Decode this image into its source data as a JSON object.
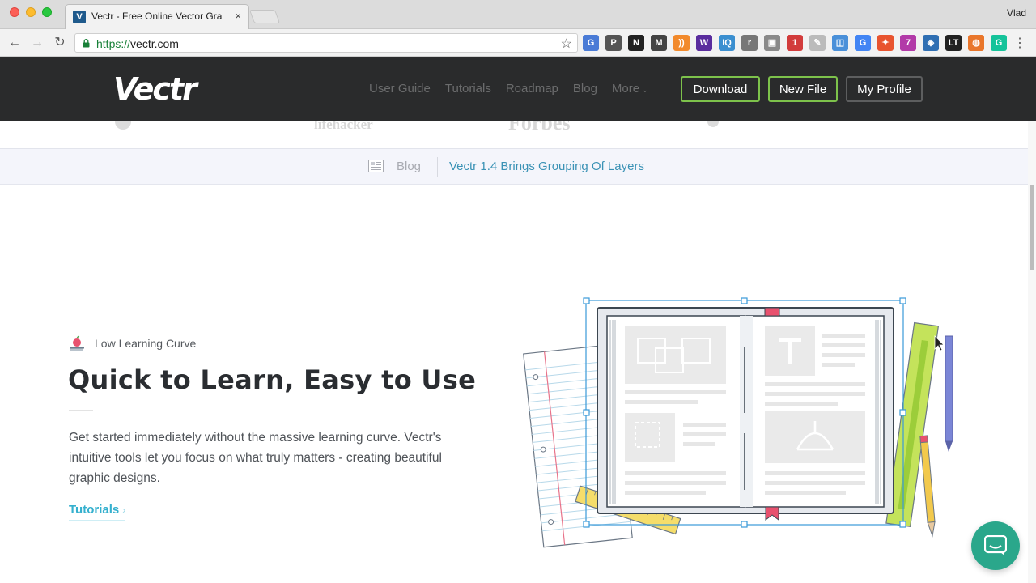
{
  "browser": {
    "tab_title": "Vectr - Free Online Vector Gra",
    "tab_favicon": "V",
    "tab_close": "×",
    "user": "Vlad",
    "url_scheme": "https://",
    "url_host": "vectr.com",
    "back_icon": "←",
    "forward_icon": "→",
    "reload_icon": "↻",
    "star_icon": "☆",
    "menu_icon": "⋮",
    "extensions": [
      {
        "label": "G",
        "color": "#4a7bd6"
      },
      {
        "label": "P",
        "color": "#555555"
      },
      {
        "label": "N",
        "color": "#222222"
      },
      {
        "label": "M",
        "color": "#444444"
      },
      {
        "label": "))",
        "color": "#f28a2c"
      },
      {
        "label": "W",
        "color": "#5a2d9e"
      },
      {
        "label": "IQ",
        "color": "#3b8fd0"
      },
      {
        "label": "r",
        "color": "#777777"
      },
      {
        "label": "▣",
        "color": "#8a8a8a"
      },
      {
        "label": "1",
        "color": "#d23c3c"
      },
      {
        "label": "✎",
        "color": "#bbbbbb"
      },
      {
        "label": "◫",
        "color": "#4a90d9"
      },
      {
        "label": "G",
        "color": "#4285f4"
      },
      {
        "label": "✦",
        "color": "#e8542f"
      },
      {
        "label": "7",
        "color": "#b23aa8"
      },
      {
        "label": "◈",
        "color": "#2f6fb3"
      },
      {
        "label": "LT",
        "color": "#222222"
      },
      {
        "label": "◍",
        "color": "#e9762b"
      },
      {
        "label": "G",
        "color": "#15c39a"
      }
    ]
  },
  "header": {
    "logo": "Vectr",
    "nav": [
      "User Guide",
      "Tutorials",
      "Roadmap",
      "Blog"
    ],
    "more": "More",
    "download": "Download",
    "new_file": "New File",
    "my_profile": "My Profile"
  },
  "press": [
    "lifehacker",
    "Forbes"
  ],
  "blog_bar": {
    "label": "Blog",
    "headline": "Vectr 1.4 Brings Grouping Of Layers"
  },
  "feature": {
    "tag": "Low Learning Curve",
    "title": "Quick to Learn, Easy to Use",
    "description": "Get started immediately without the massive learning curve. Vectr's intuitive tools let you focus on what truly matters - creating beautiful graphic designs.",
    "link": "Tutorials",
    "link_chevron": "›"
  },
  "colors": {
    "header_bg": "#2a2b2c",
    "accent_green": "#7dc24b",
    "link_blue": "#3a92b5",
    "link_cyan": "#35b0ce",
    "chat_green": "#2aa78b"
  }
}
